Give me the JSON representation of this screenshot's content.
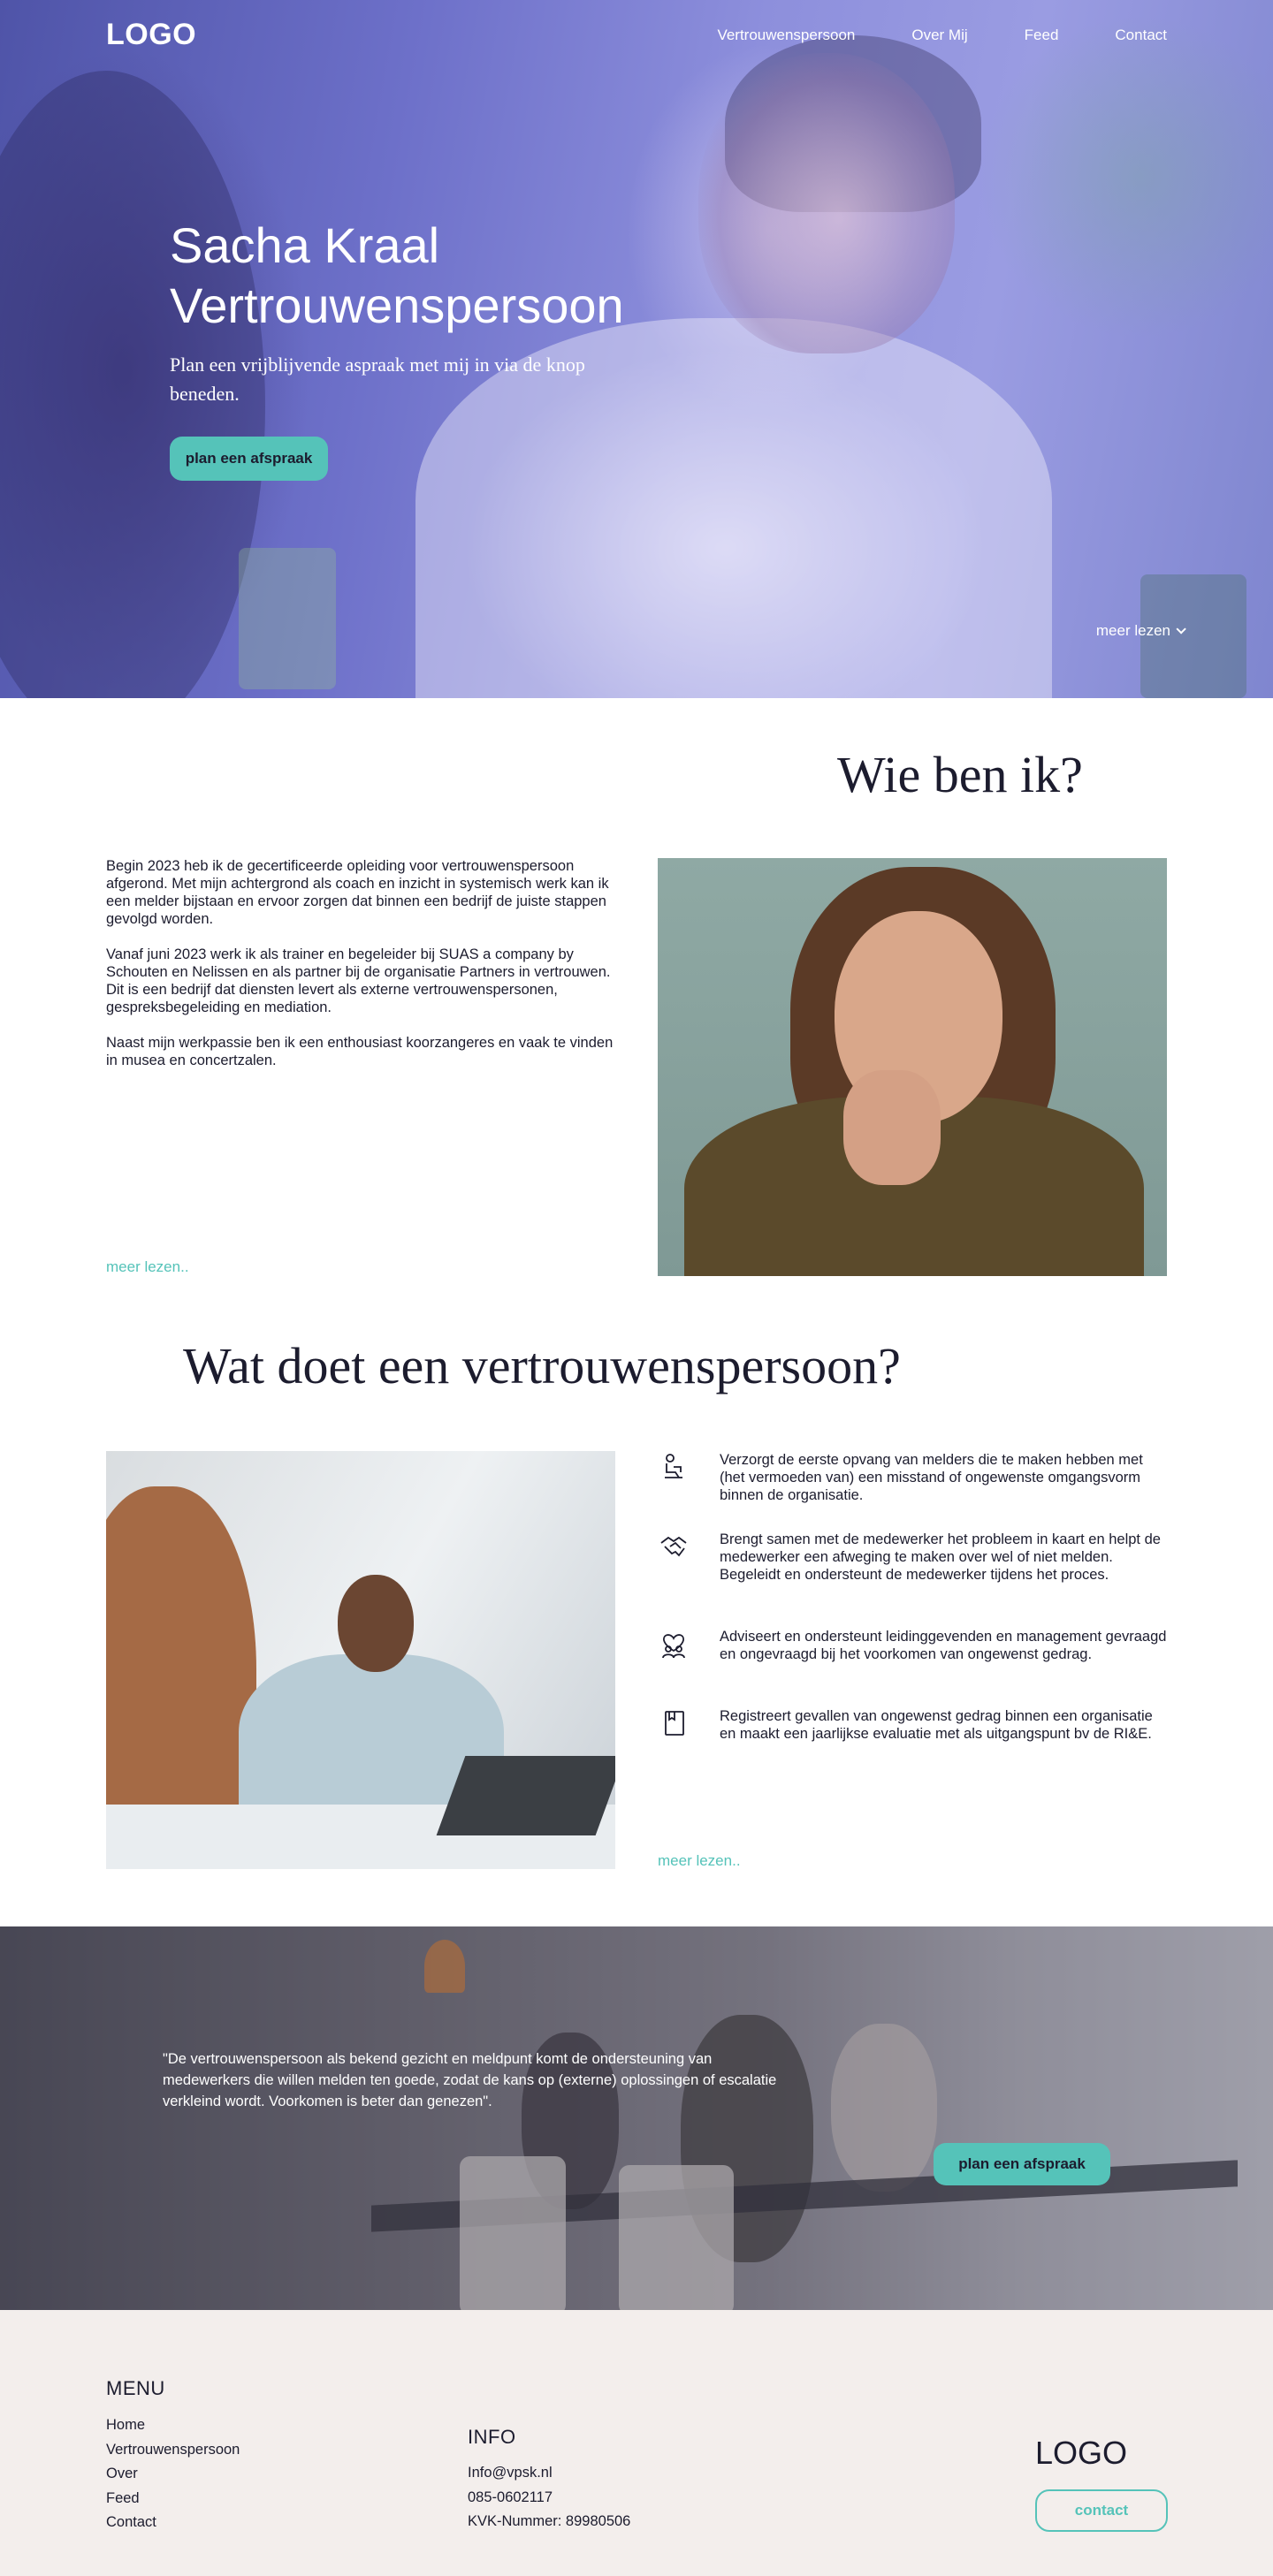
{
  "header": {
    "logo": "LOGO",
    "nav": [
      "Vertrouwenspersoon",
      "Over Mij",
      "Feed",
      "Contact"
    ]
  },
  "hero": {
    "title_line1": "Sacha Kraal",
    "title_line2": "Vertrouwenspersoon",
    "subtitle": "Plan een vrijblijvende aspraak met mij in via de knop beneden.",
    "button": "plan een afspraak",
    "more": "meer lezen"
  },
  "about": {
    "title": "Wie ben ik?",
    "paragraphs": [
      "Begin 2023 heb ik de gecertificeerde opleiding voor vertrouwenspersoon afgerond. Met mijn achtergrond als coach en inzicht in systemisch werk kan ik een melder bijstaan en ervoor zorgen dat binnen een bedrijf de juiste stappen gevolgd worden.",
      "Vanaf juni 2023 werk ik als trainer en begeleider bij SUAS a company by Schouten en Nelissen en als partner bij de organisatie Partners in vertrouwen. Dit is een bedrijf dat diensten levert als externe vertrouwenspersonen, gespreksbegeleiding en mediation.",
      "Naast mijn werkpassie ben ik een enthousiast koorzangeres en vaak te vinden in musea en concertzalen."
    ],
    "more": "meer lezen.."
  },
  "role": {
    "title": "Wat doet een vertrouwenspersoon?",
    "tasks": [
      {
        "icon": "person-at-desk-icon",
        "text": "Verzorgt de eerste opvang van melders die te maken hebben met (het vermoeden van) een misstand of ongewenste omgangsvorm binnen de organisatie."
      },
      {
        "icon": "handshake-icon",
        "text": "Brengt samen met de medewerker het probleem in kaart en helpt de medewerker een afweging te maken over wel of niet melden. Begeleidt en ondersteunt de medewerker tijdens het proces."
      },
      {
        "icon": "people-heart-icon",
        "text": "Adviseert en ondersteunt leidinggevenden en management gevraagd en ongevraagd bij het voorkomen van ongewenst gedrag."
      },
      {
        "icon": "book-icon",
        "text": "Registreert gevallen van ongewenst gedrag binnen een organisatie en maakt een jaarlijkse evaluatie met als uitgangspunt bv de RI&E."
      }
    ],
    "more": "meer lezen.."
  },
  "banner": {
    "quote": "\"De vertrouwenspersoon als bekend gezicht en meldpunt komt de ondersteuning van medewerkers die willen melden ten goede, zodat de kans op (externe) oplossingen of escalatie verkleind wordt. Voorkomen is beter dan genezen\".",
    "button": "plan een afspraak"
  },
  "footer": {
    "menu_title": "MENU",
    "menu": [
      "Home",
      "Vertrouwenspersoon",
      "Over",
      "Feed",
      "Contact"
    ],
    "info_title": "INFO",
    "info": [
      "Info@vpsk.nl",
      "085-0602117",
      "KVK-Nummer: 89980506"
    ],
    "logo": "LOGO",
    "contact_button": "contact"
  },
  "colors": {
    "accent": "#55c3b9",
    "text": "#1c1c2e",
    "footer_bg": "#f3eeec",
    "hero_overlay": "#6d70c9"
  }
}
